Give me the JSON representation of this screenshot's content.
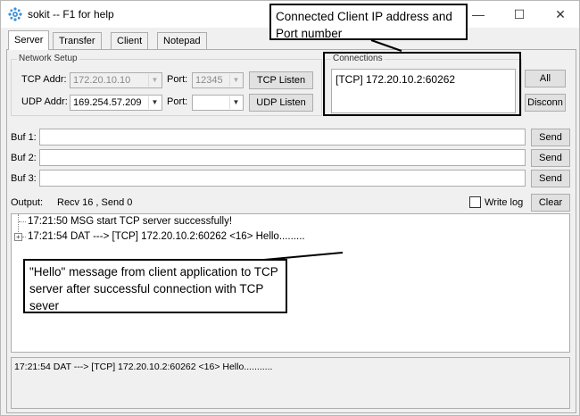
{
  "window": {
    "title": "sokit -- F1 for help",
    "controls": {
      "minimize": "—",
      "maximize": "☐",
      "close": "✕"
    }
  },
  "tabs": [
    {
      "label": "Server"
    },
    {
      "label": "Transfer"
    },
    {
      "label": "Client"
    },
    {
      "label": "Notepad"
    }
  ],
  "network_setup": {
    "title": "Network Setup",
    "tcp_addr_label": "TCP Addr:",
    "tcp_addr_value": "172.20.10.10",
    "tcp_port_label": "Port:",
    "tcp_port_value": "12345",
    "tcp_listen_button": "TCP Listen",
    "udp_addr_label": "UDP Addr:",
    "udp_addr_value": "169.254.57.209",
    "udp_port_label": "Port:",
    "udp_port_value": "",
    "udp_listen_button": "UDP Listen"
  },
  "connections": {
    "title": "Connections",
    "items": [
      "[TCP] 172.20.10.2:60262"
    ],
    "all_button": "All",
    "disconn_button": "Disconn"
  },
  "buffers": [
    {
      "label": "Buf 1:",
      "value": "",
      "send": "Send"
    },
    {
      "label": "Buf 2:",
      "value": "",
      "send": "Send"
    },
    {
      "label": "Buf 3:",
      "value": "",
      "send": "Send"
    }
  ],
  "output": {
    "label": "Output:",
    "counters": "Recv 16 , Send 0",
    "write_log_label": "Write log",
    "write_log_checked": false,
    "clear_button": "Clear",
    "log": [
      "17:21:50 MSG start TCP server successfully!",
      "17:21:54 DAT ---> [TCP] 172.20.10.2:60262 <16> Hello........."
    ],
    "expander": "+"
  },
  "status_bar": {
    "text": "17:21:54 DAT ---> [TCP] 172.20.10.2:60262 <16> Hello..........."
  },
  "annotations": {
    "connections_callout": "Connected Client IP address and Port number",
    "hello_callout": "\"Hello\" message from client application to TCP server after successful connection with TCP sever"
  },
  "colors": {
    "window_bg": "#f0f0f0",
    "border": "#adadad",
    "app_icon": "#3c8fd8",
    "callout_border": "#000000"
  },
  "icons": {
    "app": "gear-icon",
    "combo_arrow": "chevron-down-icon"
  }
}
